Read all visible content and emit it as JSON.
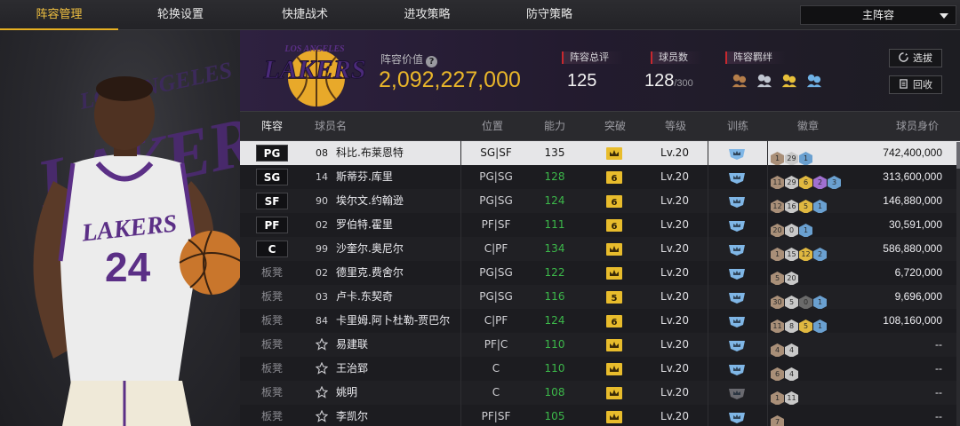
{
  "nav": {
    "tabs": [
      {
        "label": "阵容管理",
        "active": true
      },
      {
        "label": "轮换设置",
        "active": false
      },
      {
        "label": "快捷战术",
        "active": false
      },
      {
        "label": "进攻策略",
        "active": false
      },
      {
        "label": "防守策略",
        "active": false
      }
    ],
    "lineup_select": "主阵容"
  },
  "hero": {
    "bg_word": "LAKERS",
    "bg_arc": "LOS ANGELES",
    "jersey_team": "LAKERS",
    "jersey_number": "24"
  },
  "team": {
    "logo_arc": "LOS ANGELES",
    "logo_word": "LAKERS",
    "value_label": "阵容价值",
    "value": "2,092,227,000",
    "rating_label": "阵容总评",
    "rating": "125",
    "players_label": "球员数",
    "players": "128",
    "players_max": "/300",
    "chem_label": "阵容羁绊",
    "chem_icons": [
      "chem-icon-1",
      "chem-icon-2",
      "chem-icon-3",
      "chem-icon-4"
    ],
    "buttons": {
      "select": "选拔",
      "recycle": "回收"
    }
  },
  "table": {
    "headers": {
      "role": "阵容",
      "name": "球员名",
      "pos": "位置",
      "ovr": "能力",
      "breakthrough": "突破",
      "level": "等级",
      "training": "训练",
      "badges": "徽章",
      "salary": "球员身价"
    },
    "rows": [
      {
        "role": "PG",
        "starter": true,
        "num": "08",
        "name": "科比.布莱恩特",
        "pos": "SG|SF",
        "ovr": "135",
        "ovr_green": false,
        "brk": "crown",
        "lvl": "Lv.20",
        "train": "blue",
        "badges": [
          [
            "1",
            "#a98f78"
          ],
          [
            "29",
            "#c8c8c8"
          ],
          [
            "1",
            "#6aa0d0"
          ]
        ],
        "salary": "742,400,000",
        "selected": true
      },
      {
        "role": "SG",
        "starter": true,
        "num": "14",
        "name": "斯蒂芬.库里",
        "pos": "PG|SG",
        "ovr": "128",
        "ovr_green": true,
        "brk": "6",
        "lvl": "Lv.20",
        "train": "blue",
        "badges": [
          [
            "11",
            "#a98f78"
          ],
          [
            "29",
            "#c8c8c8"
          ],
          [
            "6",
            "#e0b840"
          ],
          [
            "2",
            "#a070d0"
          ],
          [
            "3",
            "#6aa0d0"
          ]
        ],
        "salary": "313,600,000",
        "selected": false
      },
      {
        "role": "SF",
        "starter": true,
        "num": "90",
        "name": "埃尔文.约翰逊",
        "pos": "PG|SG",
        "ovr": "124",
        "ovr_green": true,
        "brk": "6",
        "lvl": "Lv.20",
        "train": "blue",
        "badges": [
          [
            "12",
            "#a98f78"
          ],
          [
            "16",
            "#c8c8c8"
          ],
          [
            "5",
            "#e0b840"
          ],
          [
            "1",
            "#6aa0d0"
          ]
        ],
        "salary": "146,880,000",
        "selected": false
      },
      {
        "role": "PF",
        "starter": true,
        "num": "02",
        "name": "罗伯特.霍里",
        "pos": "PF|SF",
        "ovr": "111",
        "ovr_green": true,
        "brk": "6",
        "lvl": "Lv.20",
        "train": "blue",
        "badges": [
          [
            "20",
            "#a98f78"
          ],
          [
            "0",
            "#c8c8c8"
          ],
          [
            "1",
            "#6aa0d0"
          ]
        ],
        "salary": "30,591,000",
        "selected": false
      },
      {
        "role": "C",
        "starter": true,
        "num": "99",
        "name": "沙奎尔.奥尼尔",
        "pos": "C|PF",
        "ovr": "134",
        "ovr_green": true,
        "brk": "crown",
        "lvl": "Lv.20",
        "train": "blue",
        "badges": [
          [
            "1",
            "#a98f78"
          ],
          [
            "15",
            "#c8c8c8"
          ],
          [
            "12",
            "#e0b840"
          ],
          [
            "2",
            "#6aa0d0"
          ]
        ],
        "salary": "586,880,000",
        "selected": false
      },
      {
        "role": "板凳",
        "starter": false,
        "num": "02",
        "name": "德里克.费舍尔",
        "pos": "PG|SG",
        "ovr": "122",
        "ovr_green": true,
        "brk": "crown",
        "lvl": "Lv.20",
        "train": "blue",
        "badges": [
          [
            "5",
            "#a98f78"
          ],
          [
            "20",
            "#c8c8c8"
          ]
        ],
        "salary": "6,720,000",
        "selected": false
      },
      {
        "role": "板凳",
        "starter": false,
        "num": "03",
        "name": "卢卡.东契奇",
        "pos": "PG|SG",
        "ovr": "116",
        "ovr_green": true,
        "brk": "5",
        "lvl": "Lv.20",
        "train": "blue",
        "badges": [
          [
            "30",
            "#a98f78"
          ],
          [
            "5",
            "#c8c8c8"
          ],
          [
            "0",
            "#6a6a6a"
          ],
          [
            "1",
            "#6aa0d0"
          ]
        ],
        "salary": "9,696,000",
        "selected": false
      },
      {
        "role": "板凳",
        "starter": false,
        "num": "84",
        "name": "卡里姆.阿卜杜勒-贾巴尔",
        "pos": "C|PF",
        "ovr": "124",
        "ovr_green": true,
        "brk": "6",
        "lvl": "Lv.20",
        "train": "blue",
        "badges": [
          [
            "11",
            "#a98f78"
          ],
          [
            "8",
            "#c8c8c8"
          ],
          [
            "5",
            "#e0b840"
          ],
          [
            "1",
            "#6aa0d0"
          ]
        ],
        "salary": "108,160,000",
        "selected": false
      },
      {
        "role": "板凳",
        "starter": false,
        "num": "",
        "name": "易建联",
        "pos": "PF|C",
        "ovr": "110",
        "ovr_green": true,
        "brk": "crown",
        "lvl": "Lv.20",
        "train": "blue",
        "badges": [
          [
            "4",
            "#a98f78"
          ],
          [
            "4",
            "#c8c8c8"
          ]
        ],
        "salary": "--",
        "selected": false
      },
      {
        "role": "板凳",
        "starter": false,
        "num": "",
        "name": "王治郅",
        "pos": "C",
        "ovr": "110",
        "ovr_green": true,
        "brk": "crown",
        "lvl": "Lv.20",
        "train": "blue",
        "badges": [
          [
            "6",
            "#a98f78"
          ],
          [
            "4",
            "#c8c8c8"
          ]
        ],
        "salary": "--",
        "selected": false
      },
      {
        "role": "板凳",
        "starter": false,
        "num": "",
        "name": "姚明",
        "pos": "C",
        "ovr": "108",
        "ovr_green": true,
        "brk": "crown",
        "lvl": "Lv.20",
        "train": "gray",
        "badges": [
          [
            "1",
            "#a98f78"
          ],
          [
            "11",
            "#c8c8c8"
          ]
        ],
        "salary": "--",
        "selected": false
      },
      {
        "role": "板凳",
        "starter": false,
        "num": "",
        "name": "李凯尔",
        "pos": "PF|SF",
        "ovr": "105",
        "ovr_green": true,
        "brk": "crown",
        "lvl": "Lv.20",
        "train": "blue",
        "badges": [
          [
            "7",
            "#a98f78"
          ]
        ],
        "salary": "--",
        "selected": false
      }
    ]
  }
}
